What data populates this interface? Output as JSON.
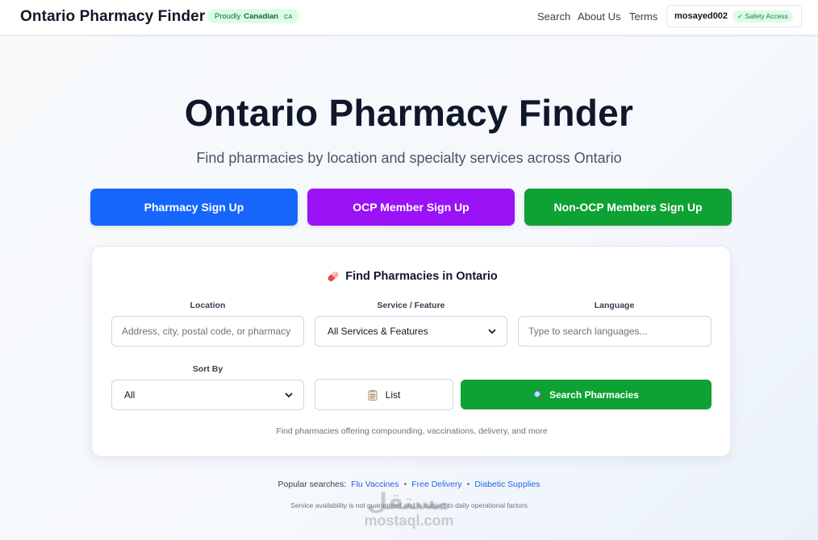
{
  "header": {
    "brand": "Ontario Pharmacy Finder",
    "badge": {
      "prefix": "Proudly",
      "country": "Canadian",
      "code": "CA"
    },
    "nav": [
      "Search",
      "About Us",
      "Terms"
    ],
    "user": {
      "name": "mosayed002",
      "badge": "✓ Safety Access"
    }
  },
  "hero": {
    "title": "Ontario Pharmacy Finder",
    "subtitle": "Find pharmacies by location and specialty services across Ontario"
  },
  "signup_buttons": [
    {
      "label": "Pharmacy Sign Up",
      "color": "#1766fb"
    },
    {
      "label": "OCP Member Sign Up",
      "color": "#9a12f5"
    },
    {
      "label": "Non-OCP Members Sign Up",
      "color": "#0ea133"
    }
  ],
  "search_card": {
    "title": "Find Pharmacies in Ontario",
    "title_icon": "pill-icon",
    "location": {
      "label": "Location",
      "placeholder": "Address, city, postal code, or pharmacy"
    },
    "service": {
      "label": "Service / Feature",
      "value": "All Services & Features"
    },
    "language": {
      "label": "Language",
      "placeholder": "Type to search languages..."
    },
    "sort": {
      "label": "Sort By",
      "value": "All"
    },
    "list_button": {
      "label": "List",
      "icon": "clipboard-icon"
    },
    "search_button": {
      "label": "Search Pharmacies",
      "icon": "magnifier-icon"
    },
    "hint": "Find pharmacies offering compounding, vaccinations, delivery, and more"
  },
  "popular": {
    "label": "Popular searches:",
    "items": [
      "Flu Vaccines",
      "Free Delivery",
      "Diabetic Supplies"
    ]
  },
  "disclaimer": "Service availability is not guaranteed and is subject to daily operational factors",
  "watermark": {
    "arabic": "مستقل",
    "latin": "mostaql.com"
  }
}
